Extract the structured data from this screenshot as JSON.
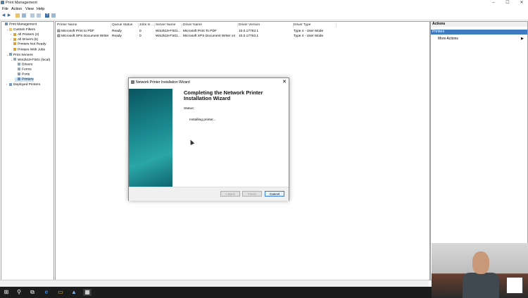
{
  "window": {
    "title": "Print Management"
  },
  "menu": [
    "File",
    "Action",
    "View",
    "Help"
  ],
  "window_controls": [
    "–",
    "☐",
    "✕"
  ],
  "tree": [
    {
      "label": "Print Management",
      "level": 0,
      "expander": ""
    },
    {
      "label": "Custom Filters",
      "level": 1,
      "expander": "⌄"
    },
    {
      "label": "All Printers (2)",
      "level": 2,
      "expander": "›"
    },
    {
      "label": "All Drivers (5)",
      "level": 2,
      "expander": "›"
    },
    {
      "label": "Printers Not Ready",
      "level": 2,
      "expander": ""
    },
    {
      "label": "Printers With Jobs",
      "level": 2,
      "expander": ""
    },
    {
      "label": "Print Servers",
      "level": 1,
      "expander": "⌄"
    },
    {
      "label": "Win2k19-FS01 (local)",
      "level": 2,
      "expander": "⌄"
    },
    {
      "label": "Drivers",
      "level": 3,
      "expander": ""
    },
    {
      "label": "Forms",
      "level": 3,
      "expander": ""
    },
    {
      "label": "Ports",
      "level": 3,
      "expander": ""
    },
    {
      "label": "Printers",
      "level": 3,
      "expander": "",
      "selected": true
    },
    {
      "label": "Deployed Printers",
      "level": 1,
      "expander": "›"
    }
  ],
  "list": {
    "columns": [
      "Printer Name",
      "Queue Status",
      "Jobs In ...",
      "Server Name",
      "Driver Name",
      "Driver Version",
      "Driver Type"
    ],
    "rows": [
      [
        "Microsoft Print to PDF",
        "Ready",
        "0",
        "Win2k19-FS01...",
        "Microsoft Print To PDF",
        "10.0.17763.1",
        "Type 4 - User Mode"
      ],
      [
        "Microsoft XPS Document Writer",
        "Ready",
        "0",
        "Win2k19-FS01...",
        "Microsoft XPS Document Writer v4",
        "10.0.17763.1",
        "Type 4 - User Mode"
      ]
    ]
  },
  "actions": {
    "header": "Actions",
    "section": "Printers",
    "more": "More Actions"
  },
  "wizard": {
    "title": "Network Printer Installation Wizard",
    "heading": "Completing the Network Printer Installation Wizard",
    "status_label": "Status:",
    "progress_text": "Installing printer...",
    "back_label": "< Back",
    "finish_label": "Finish",
    "cancel_label": "Cancel"
  },
  "taskbar": [
    "⊞",
    "⚲",
    "⧉",
    "e",
    "▭",
    "▲",
    "▦"
  ],
  "colors": {
    "accent": "#3e7bc4",
    "wizard_side": "#1b8a90",
    "taskbar": "#1c1c1c"
  }
}
